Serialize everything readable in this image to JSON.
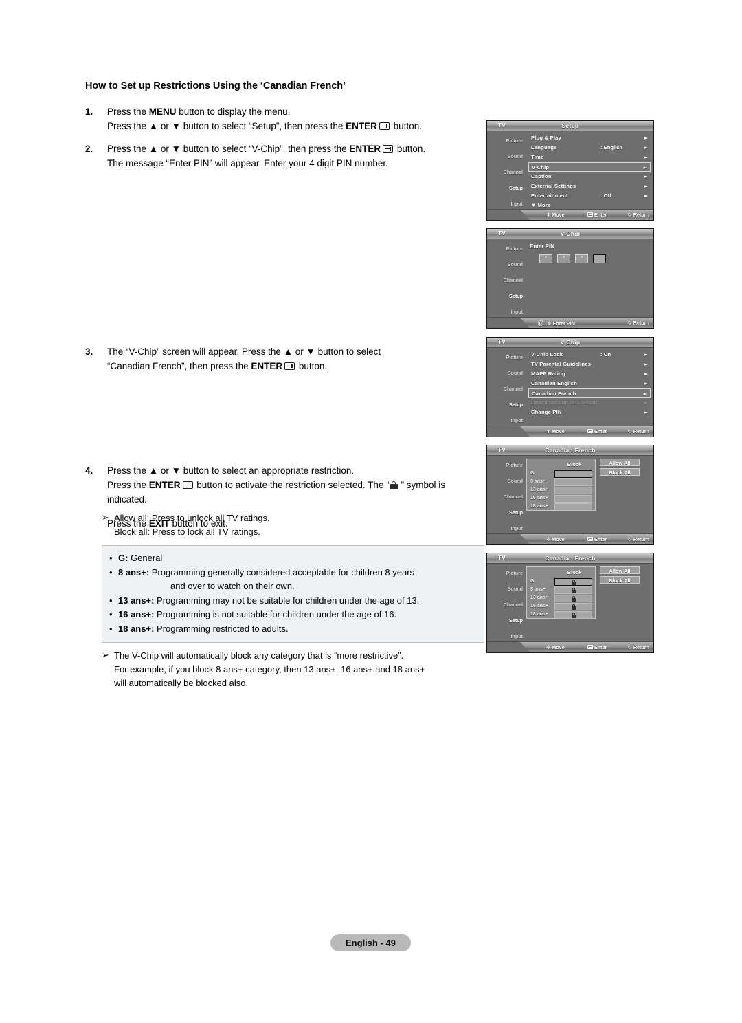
{
  "heading": "How to Set up Restrictions Using the ‘Canadian French’",
  "steps": [
    {
      "num": "1.",
      "lines": [
        {
          "pre": "Press the ",
          "bold": "MENU",
          "post": " button to display the menu."
        },
        {
          "pre": "Press the ▲ or ▼ button to select “Setup”, then press the ",
          "bold": "ENTER",
          "post": " button."
        }
      ]
    },
    {
      "num": "2.",
      "lines": [
        {
          "pre": "Press the ▲ or ▼ button to select “V-Chip”, then press the ",
          "bold": "ENTER",
          "post": " button."
        },
        {
          "pre": "The message “Enter PIN” will appear. Enter your 4 digit PIN number.",
          "bold": "",
          "post": ""
        }
      ]
    },
    {
      "num": "3.",
      "lines": [
        {
          "pre": "The “V-Chip” screen will appear. Press the ▲ or ▼ button to select",
          "bold": "",
          "post": ""
        },
        {
          "pre": "“Canadian French”, then press the ",
          "bold": "ENTER",
          "post": " button."
        }
      ]
    },
    {
      "num": "4.",
      "lines": [
        {
          "pre": "Press the ▲ or ▼ button to select an appropriate restriction.",
          "bold": "",
          "post": ""
        },
        {
          "pre": "Press the ",
          "bold": "ENTER",
          "post": " button to activate the restriction selected. The “"
        },
        {
          "pre": "indicated.",
          "bold": "",
          "post": ""
        },
        {
          "pre": "Press the ",
          "bold": "EXIT",
          "post": " button to exit."
        }
      ],
      "lock_tail": " ” symbol is"
    }
  ],
  "notes": {
    "note1": {
      "marker": "➢",
      "line1": "Allow all: Press to unlock all TV ratings.",
      "line2": "Block all: Press to lock all TV ratings."
    },
    "ratings": [
      {
        "dot": "•",
        "code": "G:",
        "desc": " General",
        "cont": ""
      },
      {
        "dot": "•",
        "code": "8 ans+:",
        "desc": " Programming generally considered acceptable for children 8 years",
        "cont": "and over to watch on their own."
      },
      {
        "dot": "•",
        "code": "13 ans+:",
        "desc": " Programming may not be suitable for children under the age of 13.",
        "cont": ""
      },
      {
        "dot": "•",
        "code": "16 ans+:",
        "desc": " Programming is not suitable for children under the age of 16.",
        "cont": ""
      },
      {
        "dot": "•",
        "code": "18 ans+:",
        "desc": " Programming restricted to adults.",
        "cont": ""
      }
    ],
    "note2": {
      "marker": "➢",
      "line1": "The V-Chip will automatically block any category that is “more restrictive”.",
      "line2": "For example, if you block 8 ans+ category, then 13 ans+, 16 ans+ and 18 ans+",
      "line3": "will automatically be blocked also."
    }
  },
  "osd": {
    "tv_tag": "TV",
    "rail": [
      "Picture",
      "Sound",
      "Channel",
      "Setup",
      "Input"
    ],
    "hints": {
      "move": "Move",
      "enter": "Enter",
      "return": "Return",
      "enter_pin": "Enter PIN",
      "pin_digits": "0..9"
    },
    "screen1": {
      "title": "Setup",
      "rows": [
        {
          "label": "Plug & Play",
          "value": "",
          "arrow": "►",
          "selected": false,
          "disabled": false
        },
        {
          "label": "Language",
          "value": ": English",
          "arrow": "►",
          "selected": false,
          "disabled": false
        },
        {
          "label": "Time",
          "value": "",
          "arrow": "►",
          "selected": false,
          "disabled": false
        },
        {
          "label": "V-Chip",
          "value": "",
          "arrow": "►",
          "selected": true,
          "disabled": false
        },
        {
          "label": "Caption",
          "value": "",
          "arrow": "►",
          "selected": false,
          "disabled": false
        },
        {
          "label": "External Settings",
          "value": "",
          "arrow": "►",
          "selected": false,
          "disabled": false
        },
        {
          "label": "Entertainment",
          "value": ": Off",
          "arrow": "►",
          "selected": false,
          "disabled": false
        },
        {
          "label": "▼ More",
          "value": "",
          "arrow": "",
          "selected": false,
          "disabled": false
        }
      ]
    },
    "screen2": {
      "title": "V-Chip",
      "pin_label": "Enter PIN",
      "pin_boxes": [
        "*",
        "*",
        "*",
        ""
      ]
    },
    "screen3": {
      "title": "V-Chip",
      "rows": [
        {
          "label": "V-Chip Lock",
          "value": ": On",
          "arrow": "►",
          "selected": false,
          "disabled": false
        },
        {
          "label": "TV Parental Guidelines",
          "value": "",
          "arrow": "►",
          "selected": false,
          "disabled": false
        },
        {
          "label": "MAPP Rating",
          "value": "",
          "arrow": "►",
          "selected": false,
          "disabled": false
        },
        {
          "label": "Canadian English",
          "value": "",
          "arrow": "►",
          "selected": false,
          "disabled": false
        },
        {
          "label": "Canadian French",
          "value": "",
          "arrow": "►",
          "selected": true,
          "disabled": false
        },
        {
          "label": "Downloadable U.S. Rating",
          "value": "",
          "arrow": "►",
          "selected": false,
          "disabled": true
        },
        {
          "label": "Change PIN",
          "value": "",
          "arrow": "►",
          "selected": false,
          "disabled": false
        }
      ]
    },
    "screen4": {
      "title": "Canadian French",
      "block_header": "Block",
      "ratings": [
        "G",
        "8 ans+",
        "13 ans+",
        "16 ans+",
        "18 ans+"
      ],
      "locked": [
        false,
        false,
        false,
        false,
        false
      ],
      "selected_index": 0,
      "allow_all": "Allow All",
      "block_all": "Block All"
    },
    "screen5": {
      "title": "Canadian French",
      "block_header": "Block",
      "ratings": [
        "G",
        "8 ans+",
        "13 ans+",
        "16 ans+",
        "18 ans+"
      ],
      "locked": [
        true,
        true,
        true,
        true,
        true
      ],
      "selected_index": 0,
      "allow_all": "Allow All",
      "block_all": "Block All"
    }
  },
  "footer": "English - 49"
}
